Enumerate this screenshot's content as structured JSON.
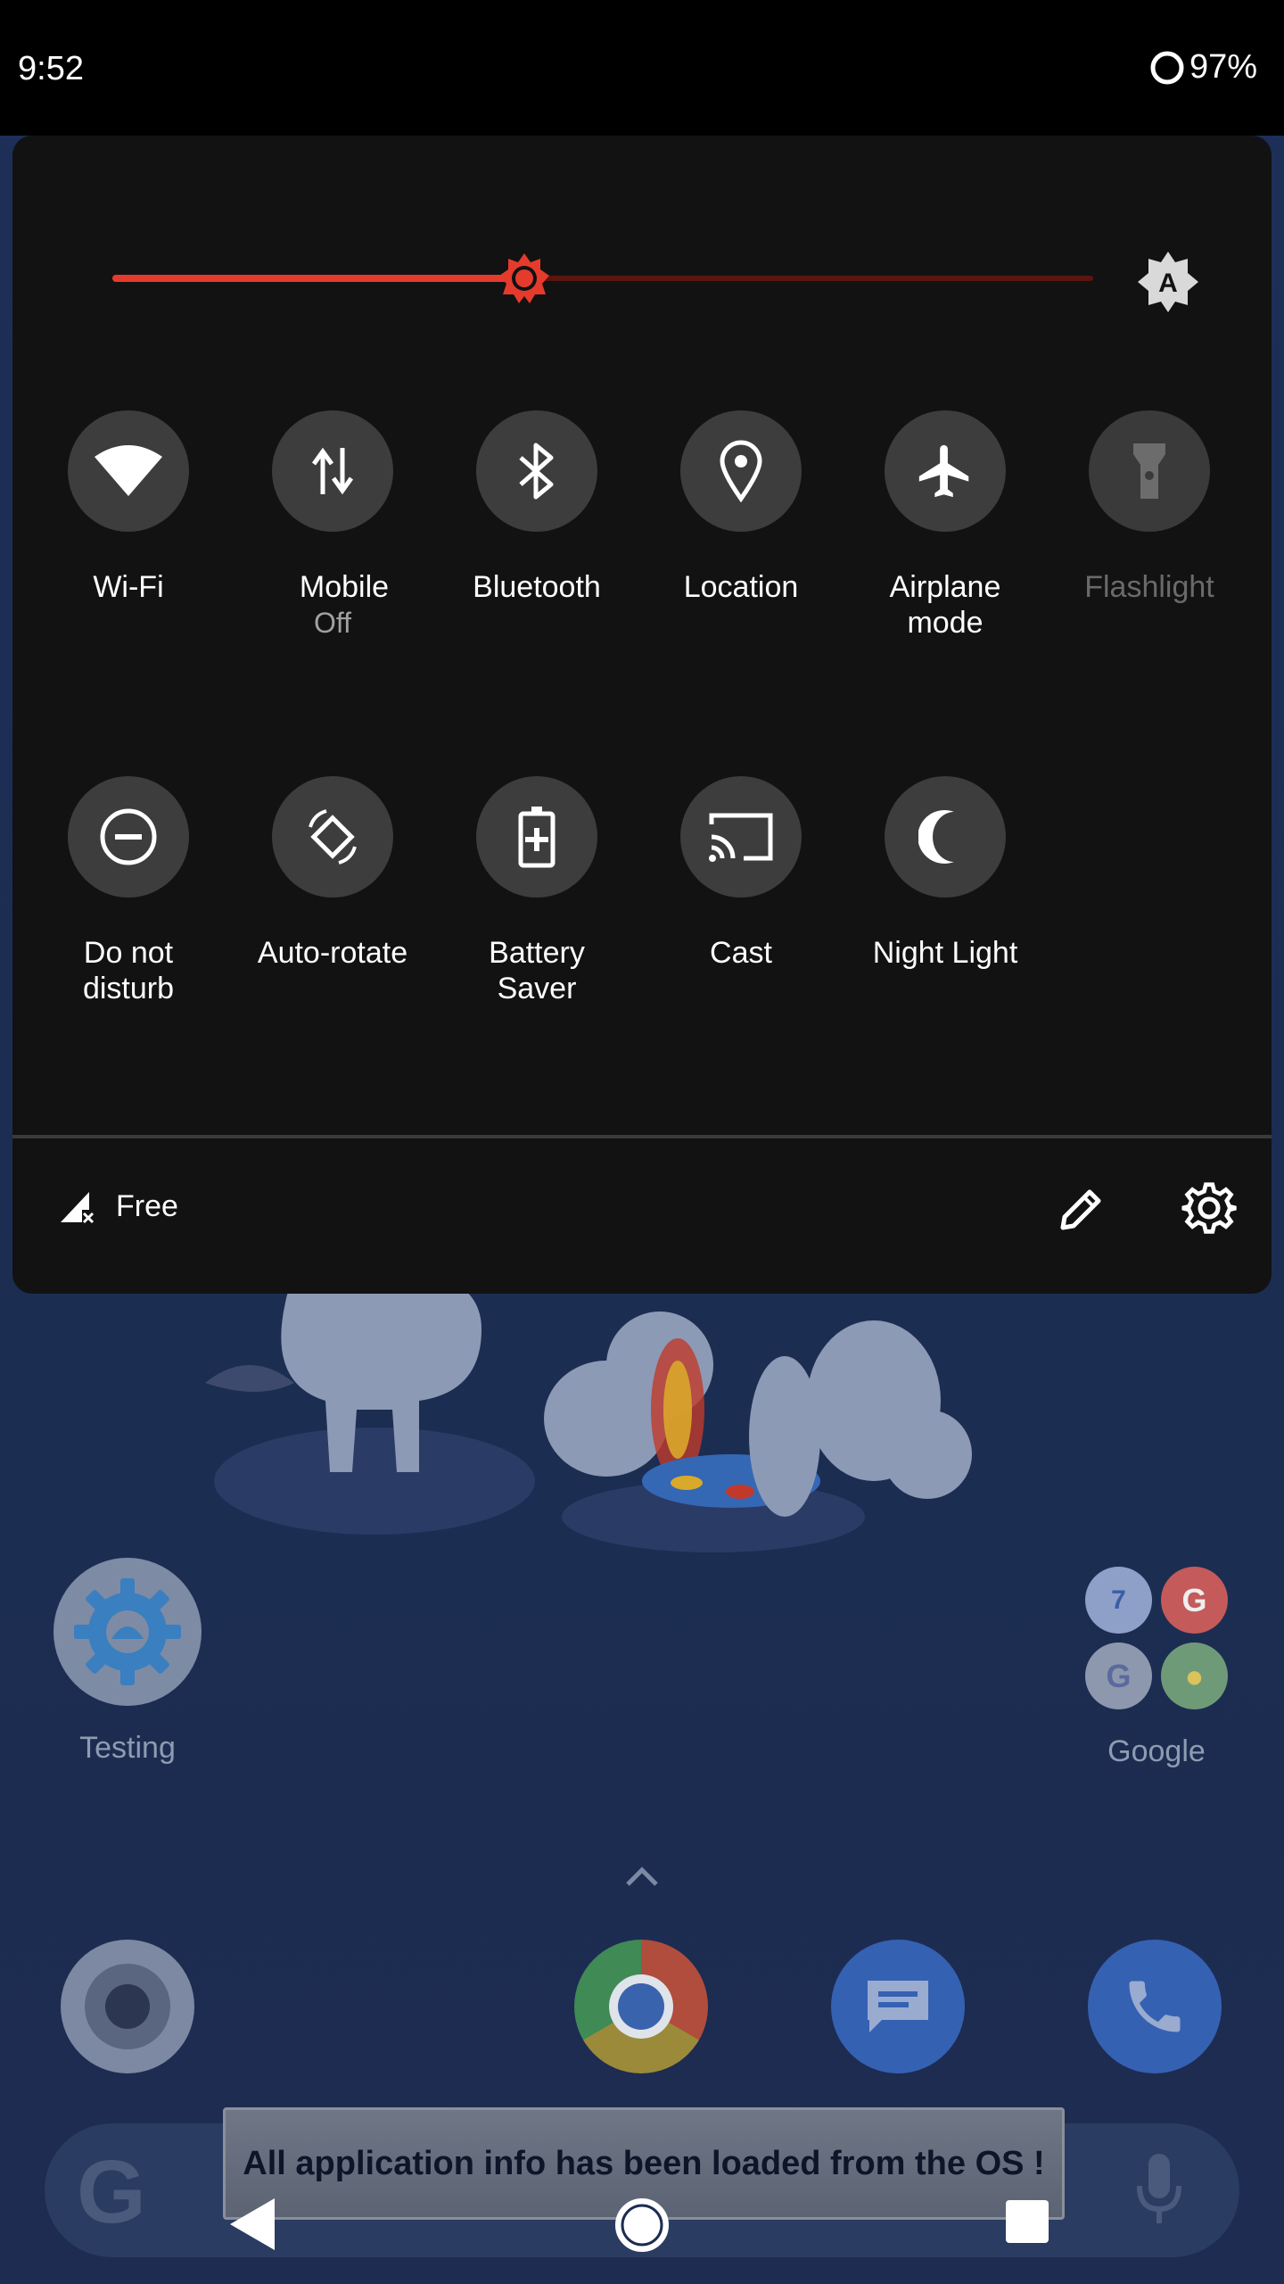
{
  "status_bar": {
    "time": "9:52",
    "battery": "97%"
  },
  "quick_settings": {
    "brightness_level": 0.42,
    "auto_brightness_icon": "A",
    "tiles": [
      {
        "id": "wifi",
        "label": "Wi-Fi",
        "sub": "",
        "icon": "wifi-icon"
      },
      {
        "id": "mobile",
        "label": "Mobile",
        "sub": "Off",
        "icon": "mobile-data-icon"
      },
      {
        "id": "bluetooth",
        "label": "Bluetooth",
        "sub": "",
        "icon": "bluetooth-icon"
      },
      {
        "id": "location",
        "label": "Location",
        "sub": "",
        "icon": "location-icon"
      },
      {
        "id": "airplane",
        "label": "Airplane mode",
        "sub": "",
        "icon": "airplane-icon"
      },
      {
        "id": "flashlight",
        "label": "Flashlight",
        "sub": "",
        "icon": "flashlight-icon"
      },
      {
        "id": "dnd",
        "label": "Do not disturb",
        "sub": "",
        "icon": "do-not-disturb-icon"
      },
      {
        "id": "autorotate",
        "label": "Auto-rotate",
        "sub": "",
        "icon": "auto-rotate-icon"
      },
      {
        "id": "battery_saver",
        "label": "Battery Saver",
        "sub": "",
        "icon": "battery-saver-icon"
      },
      {
        "id": "cast",
        "label": "Cast",
        "sub": "",
        "icon": "cast-icon"
      },
      {
        "id": "night_light",
        "label": "Night Light",
        "sub": "",
        "icon": "night-light-icon"
      }
    ],
    "footer": {
      "carrier": "Free"
    }
  },
  "home": {
    "apps": [
      {
        "label": "Testing"
      },
      {
        "label": "Google"
      }
    ],
    "folder_calendar_day": "7"
  },
  "toast": {
    "message": "All application info has been loaded from the OS !"
  },
  "colors": {
    "accent": "#e53b2c",
    "panel": "#121212",
    "tile": "#3d3d3d"
  }
}
